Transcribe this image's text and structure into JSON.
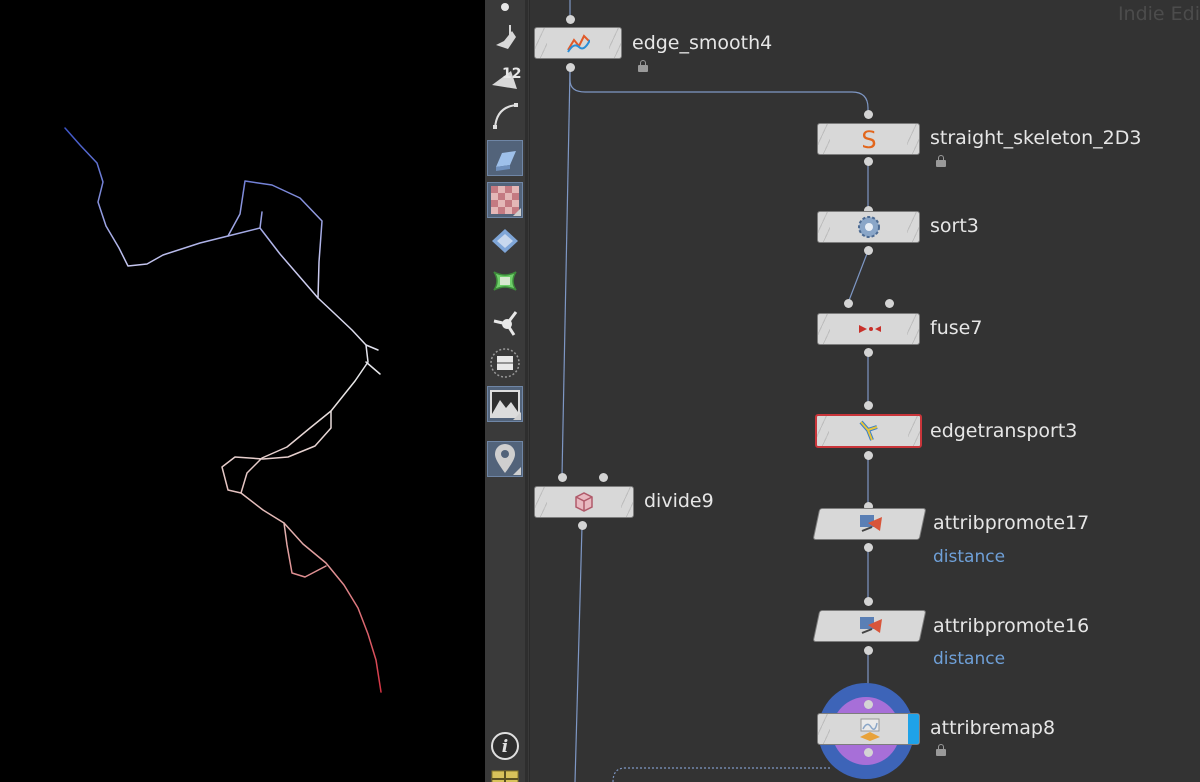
{
  "watermark": "Indie Edi",
  "shelf": {
    "tools": [
      {
        "name": "brush-tool-icon",
        "active": false,
        "corner": false
      },
      {
        "name": "sweep-tool-icon",
        "active": false,
        "corner": false
      },
      {
        "name": "polygon-count-icon",
        "active": false,
        "corner": false,
        "label": "12"
      },
      {
        "name": "curve-tool-icon",
        "active": false,
        "corner": false
      },
      {
        "name": "extrude-tool-icon",
        "active": true,
        "corner": false
      },
      {
        "name": "checker-material-icon",
        "active": true,
        "corner": true
      },
      {
        "name": "diamond-tool-icon",
        "active": false,
        "corner": false
      },
      {
        "name": "cloth-tool-icon",
        "active": false,
        "corner": false
      },
      {
        "name": "handle-tool-icon",
        "active": false,
        "corner": false
      },
      {
        "name": "box-view-icon",
        "active": false,
        "corner": false
      },
      {
        "name": "terrain-image-icon",
        "active": true,
        "corner": true
      },
      {
        "name": "location-pin-icon",
        "active": true,
        "corner": true
      }
    ],
    "info_icon": "info-icon",
    "bottom_icon": "panel-layout-icon"
  },
  "nodes": [
    {
      "id": "edge_smooth4",
      "label": "edge_smooth4",
      "icon": "edge-smooth-icon",
      "locked": true,
      "selected": false
    },
    {
      "id": "straight_skeleton_2D3",
      "label": "straight_skeleton_2D3",
      "icon": "straight-skeleton-icon",
      "glyph": "S",
      "locked": true,
      "selected": false
    },
    {
      "id": "sort3",
      "label": "sort3",
      "icon": "sort-gear-icon",
      "locked": false,
      "selected": false
    },
    {
      "id": "fuse7",
      "label": "fuse7",
      "icon": "fuse-arrows-icon",
      "locked": false,
      "selected": false
    },
    {
      "id": "edgetransport3",
      "label": "edgetransport3",
      "icon": "edge-transport-icon",
      "locked": false,
      "selected": true
    },
    {
      "id": "attribpromote17",
      "label": "attribpromote17",
      "sublabel": "distance",
      "icon": "attrib-promote-icon",
      "locked": false,
      "selected": false
    },
    {
      "id": "attribpromote16",
      "label": "attribpromote16",
      "sublabel": "distance",
      "icon": "attrib-promote-icon",
      "locked": false,
      "selected": false
    },
    {
      "id": "attribremap8",
      "label": "attribremap8",
      "icon": "attrib-remap-icon",
      "locked": true,
      "selected": false,
      "display": true
    },
    {
      "id": "divide9",
      "label": "divide9",
      "icon": "divide-cube-icon",
      "locked": false,
      "selected": false
    }
  ],
  "colors": {
    "network_bg": "#333333",
    "wire": "#7e97c4",
    "node_fill": "#d8d8d8",
    "selected_outline": "#c9353a",
    "display_flag": "#1fa2e8",
    "sublabel": "#6fa0d8",
    "curve_start": "#3c54c7",
    "curve_mid": "#e8e8e8",
    "curve_end": "#d63343"
  }
}
